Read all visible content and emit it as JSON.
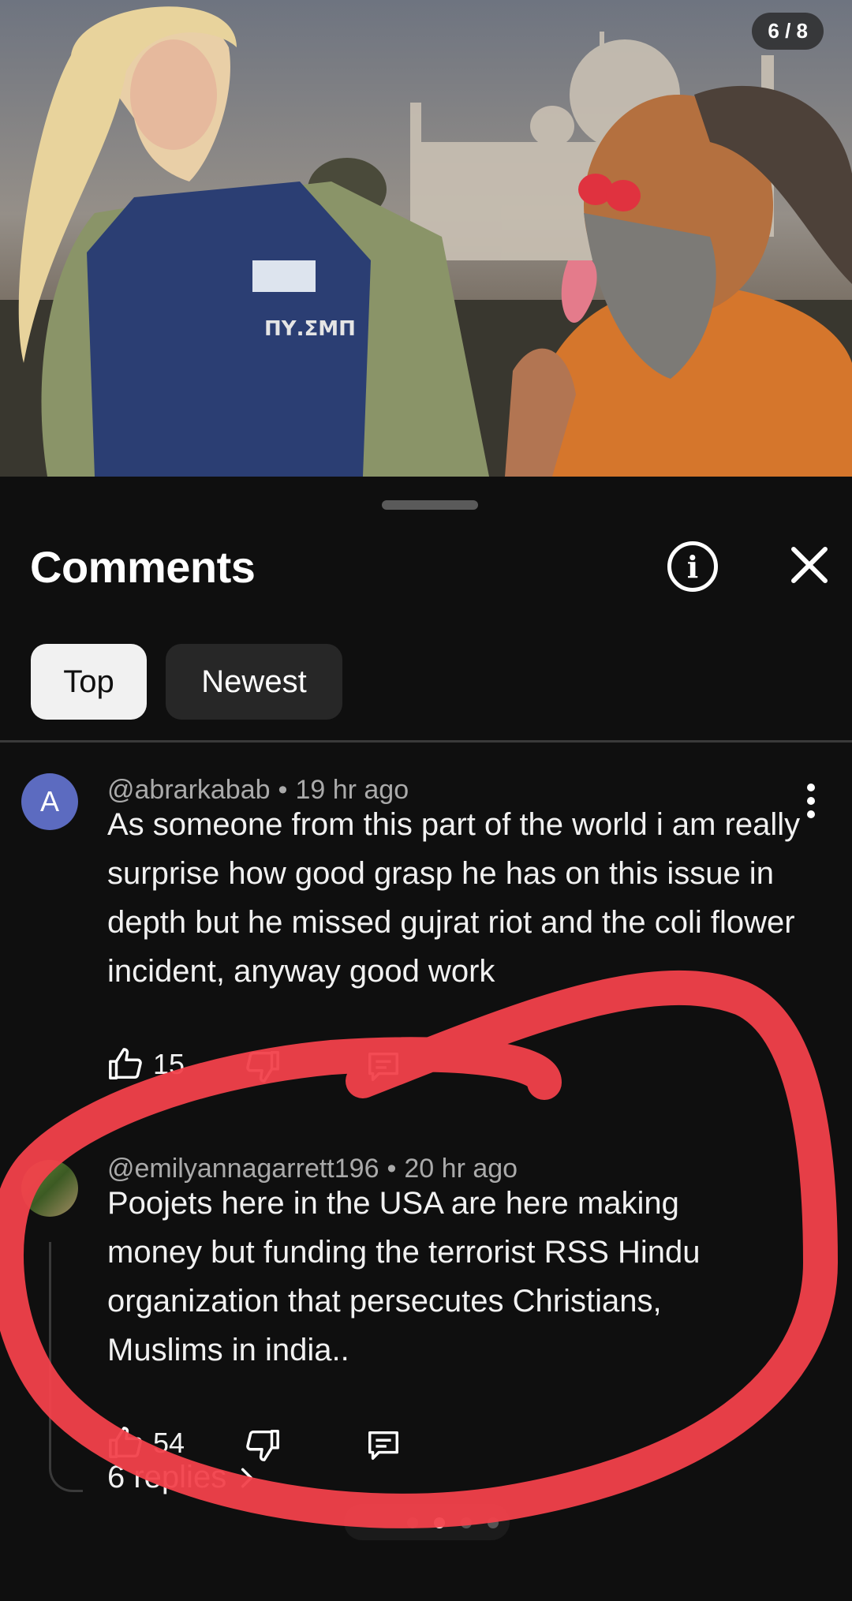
{
  "media": {
    "page_counter": "6 / 8",
    "vest_label": "ΠΥ.ΣΜΠ"
  },
  "sheet": {
    "title": "Comments",
    "tabs": [
      {
        "label": "Top",
        "selected": true
      },
      {
        "label": "Newest",
        "selected": false
      }
    ]
  },
  "comments": [
    {
      "avatar_letter": "A",
      "handle": "@abrarkabab",
      "time": "19 hr ago",
      "text": "As someone from this part of the world i am really surprise how good grasp he has on this issue in depth but he missed gujrat riot and the coli flower incident, anyway good work",
      "likes": "15"
    },
    {
      "handle": "@emilyannagarrett196",
      "time": "20 hr ago",
      "text": "Poojets here in the USA are here making money but funding the terrorist RSS Hindu organization that persecutes Christians, Muslims in india..",
      "likes": "54",
      "replies_label": "6 replies"
    }
  ],
  "colors": {
    "background": "#0f0f0f",
    "annotation": "#f2414b",
    "avatar_a": "#5c6bc0"
  }
}
